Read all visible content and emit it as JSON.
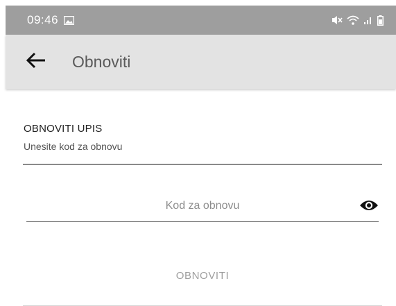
{
  "status_bar": {
    "time": "09:46",
    "icons": [
      "gallery-icon",
      "mute-icon",
      "wifi-icon",
      "signal-icon",
      "battery-icon"
    ]
  },
  "app_bar": {
    "title": "Obnoviti",
    "back_icon": "arrow-back-icon"
  },
  "form": {
    "section_title": "OBNOVITI UPIS",
    "section_subtitle": "Unesite kod za obnovu",
    "code_input": {
      "value": "",
      "placeholder": "Kod za obnovu"
    },
    "visibility_icon": "eye-icon",
    "submit_label": "OBNOVITI"
  },
  "colors": {
    "status_bar_bg": "#9e9e9e",
    "app_bar_bg": "#e3e3e3",
    "disabled_text": "#9e9e9e"
  }
}
